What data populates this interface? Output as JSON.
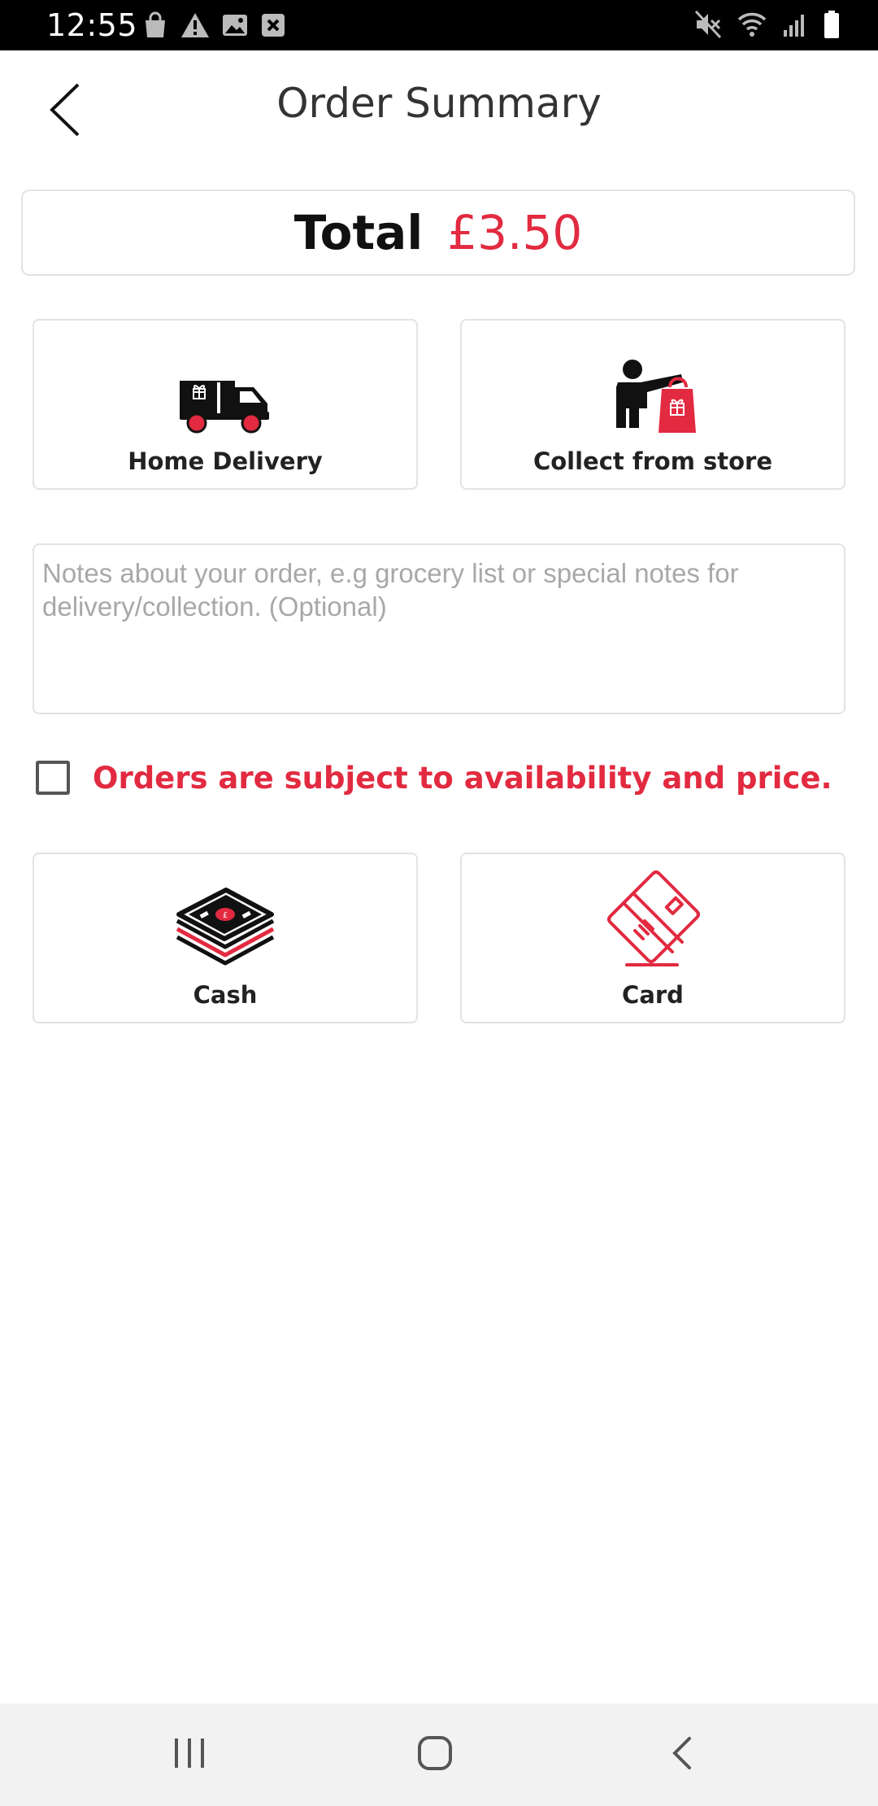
{
  "status_bar": {
    "time": "12:55",
    "left_icons": [
      "shopping-bag-icon",
      "warning-icon",
      "image-icon",
      "close-box-icon"
    ],
    "right_icons": [
      "mute-icon",
      "wifi-icon",
      "signal-icon",
      "battery-icon"
    ]
  },
  "header": {
    "title": "Order Summary",
    "back_icon": "chevron-left-icon"
  },
  "total": {
    "label": "Total",
    "amount": "£3.50"
  },
  "fulfilment_options": [
    {
      "label": "Home Delivery",
      "icon": "delivery-van-icon"
    },
    {
      "label": "Collect from store",
      "icon": "collect-person-bag-icon"
    }
  ],
  "notes": {
    "value": "",
    "placeholder": "Notes about your order, e.g grocery list or special notes for delivery/collection. (Optional)"
  },
  "terms": {
    "checked": false,
    "label": "Orders are subject to availability and price."
  },
  "payment_options": [
    {
      "label": "Cash",
      "icon": "cash-stack-icon"
    },
    {
      "label": "Card",
      "icon": "credit-card-icon"
    }
  ],
  "nav_bar": {
    "buttons": [
      "recent-apps-icon",
      "home-icon",
      "back-icon"
    ]
  },
  "colors": {
    "accent": "#e22a40",
    "border": "#e3e3e3",
    "status_bar": "#000000",
    "nav_bar": "#f2f2f2"
  }
}
